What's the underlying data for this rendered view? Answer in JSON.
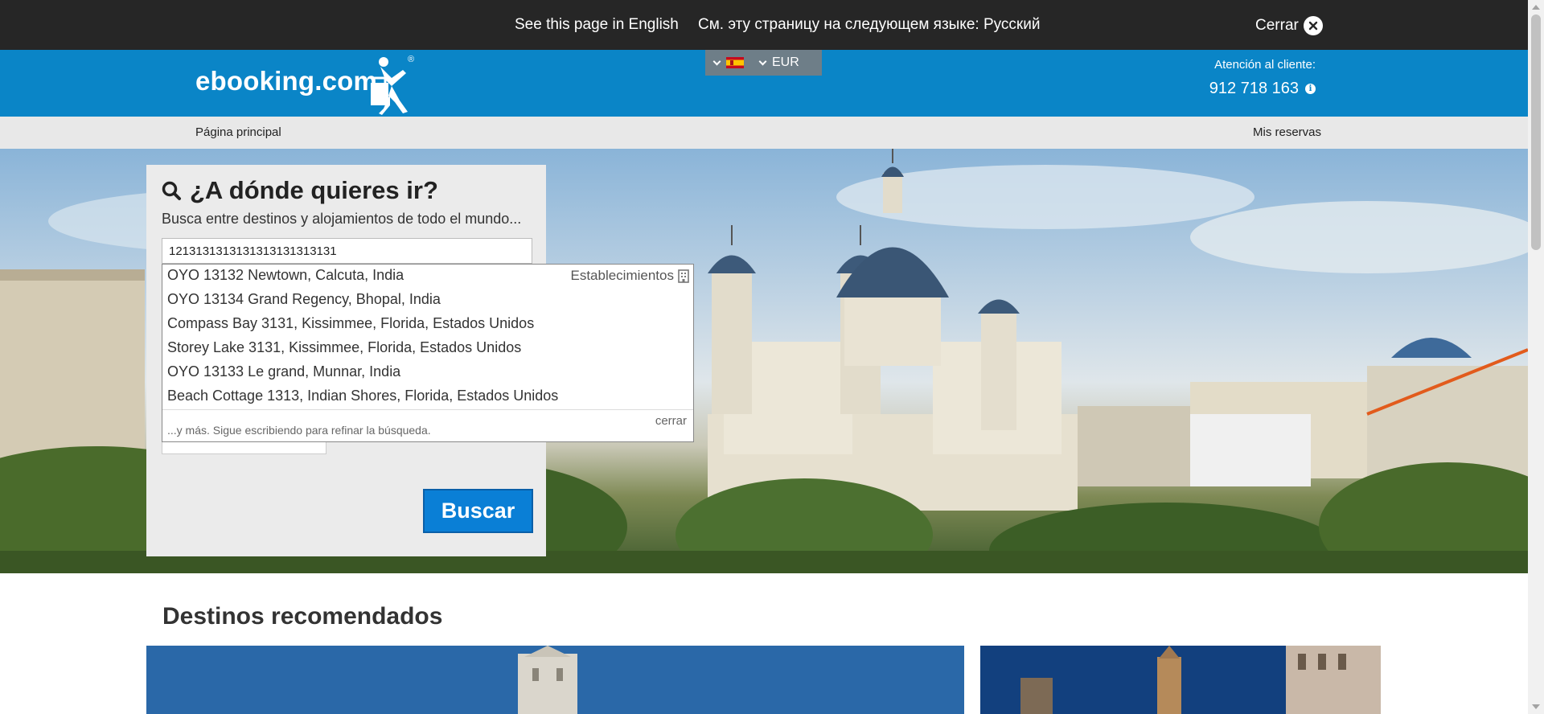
{
  "translate_bar": {
    "english_link": "See this page in English",
    "russian_link": "См. эту страницу на следующем языке: Русский",
    "close_label": "Cerrar"
  },
  "header": {
    "logo_text": "ebooking.com",
    "registered_mark": "®",
    "language_icon": "spain-flag-icon",
    "currency": "EUR",
    "customer_service_label": "Atención al cliente:",
    "phone": "912 718 163"
  },
  "nav": {
    "home": "Página principal",
    "reservations": "Mis reservas"
  },
  "search": {
    "title": "¿A dónde quieres ir?",
    "subtitle": "Busca entre destinos y alojamientos de todo el mundo...",
    "input_value": "1213131313131313131313131",
    "button_label": "Buscar"
  },
  "autocomplete": {
    "category_label": "Establecimientos",
    "items": [
      "OYO 13132 Newtown, Calcuta, India",
      "OYO 13134 Grand Regency, Bhopal, India",
      "Compass Bay 3131, Kissimmee, Florida, Estados Unidos",
      "Storey Lake 3131, Kissimmee, Florida, Estados Unidos",
      "OYO 13133 Le grand, Munnar, India",
      "Beach Cottage 1313, Indian Shores, Florida, Estados Unidos"
    ],
    "more_text": "...y más. Sigue escribiendo para refinar la búsqueda.",
    "close_label": "cerrar"
  },
  "recommended": {
    "title": "Destinos recomendados"
  },
  "colors": {
    "header_blue": "#0a85c7",
    "translate_bar": "#262626",
    "button_blue": "#0a7fd6"
  }
}
